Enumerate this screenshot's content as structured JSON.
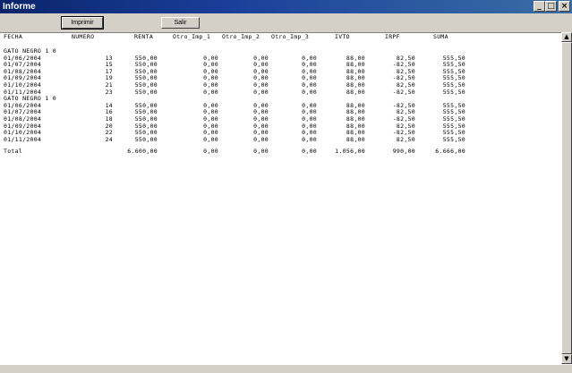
{
  "window": {
    "title": "Informe"
  },
  "titlebar_buttons": {
    "minimize": "_",
    "maximize": "□",
    "close": "×"
  },
  "toolbar": {
    "print_label": "Imprimir",
    "exit_label": "Salir"
  },
  "report": {
    "columns": [
      "FECHA",
      "NUMERO",
      "RENTA",
      "Otro_Imp_1",
      "Otro_Imp_2",
      "Otro_Imp_3",
      "IVTO",
      "IRPF",
      "SUMA"
    ],
    "groups": [
      {
        "label": "GATO NEGRO 1 0",
        "rows": [
          [
            "01/06/2004",
            "13",
            "550,00",
            "0,00",
            "0,00",
            "0,00",
            "88,00",
            "82,50",
            "555,50"
          ],
          [
            "01/07/2004",
            "15",
            "550,00",
            "0,00",
            "0,00",
            "0,00",
            "88,00",
            "-82,50",
            "555,50"
          ],
          [
            "01/08/2004",
            "17",
            "550,00",
            "0,00",
            "0,00",
            "0,00",
            "88,00",
            "82,50",
            "555,50"
          ],
          [
            "01/09/2004",
            "19",
            "550,00",
            "0,00",
            "0,00",
            "0,00",
            "88,00",
            "-82,50",
            "555,50"
          ],
          [
            "01/10/2004",
            "21",
            "550,00",
            "0,00",
            "0,00",
            "0,00",
            "88,00",
            "82,50",
            "555,50"
          ],
          [
            "01/11/2004",
            "23",
            "550,00",
            "0,00",
            "0,00",
            "0,00",
            "88,00",
            "-82,50",
            "555,50"
          ]
        ]
      },
      {
        "label": "GATO NEGRO 1 0",
        "rows": [
          [
            "01/06/2004",
            "14",
            "550,00",
            "0,00",
            "0,00",
            "0,00",
            "88,00",
            "-82,50",
            "555,50"
          ],
          [
            "01/07/2004",
            "16",
            "550,00",
            "0,00",
            "0,00",
            "0,00",
            "88,00",
            "82,50",
            "555,50"
          ],
          [
            "01/08/2004",
            "18",
            "550,00",
            "0,00",
            "0,00",
            "0,00",
            "88,00",
            "-82,50",
            "555,50"
          ],
          [
            "01/09/2004",
            "20",
            "550,00",
            "0,00",
            "0,00",
            "0,00",
            "88,00",
            "82,50",
            "555,50"
          ],
          [
            "01/10/2004",
            "22",
            "550,00",
            "0,00",
            "0,00",
            "0,00",
            "88,00",
            "-82,50",
            "555,50"
          ],
          [
            "01/11/2004",
            "24",
            "550,00",
            "0,00",
            "0,00",
            "0,00",
            "88,00",
            "82,50",
            "555,50"
          ]
        ]
      }
    ],
    "total": [
      "Total",
      "",
      "6.600,00",
      "0,00",
      "0,00",
      "0,00",
      "1.056,00",
      "990,00",
      "6.666,00"
    ]
  }
}
